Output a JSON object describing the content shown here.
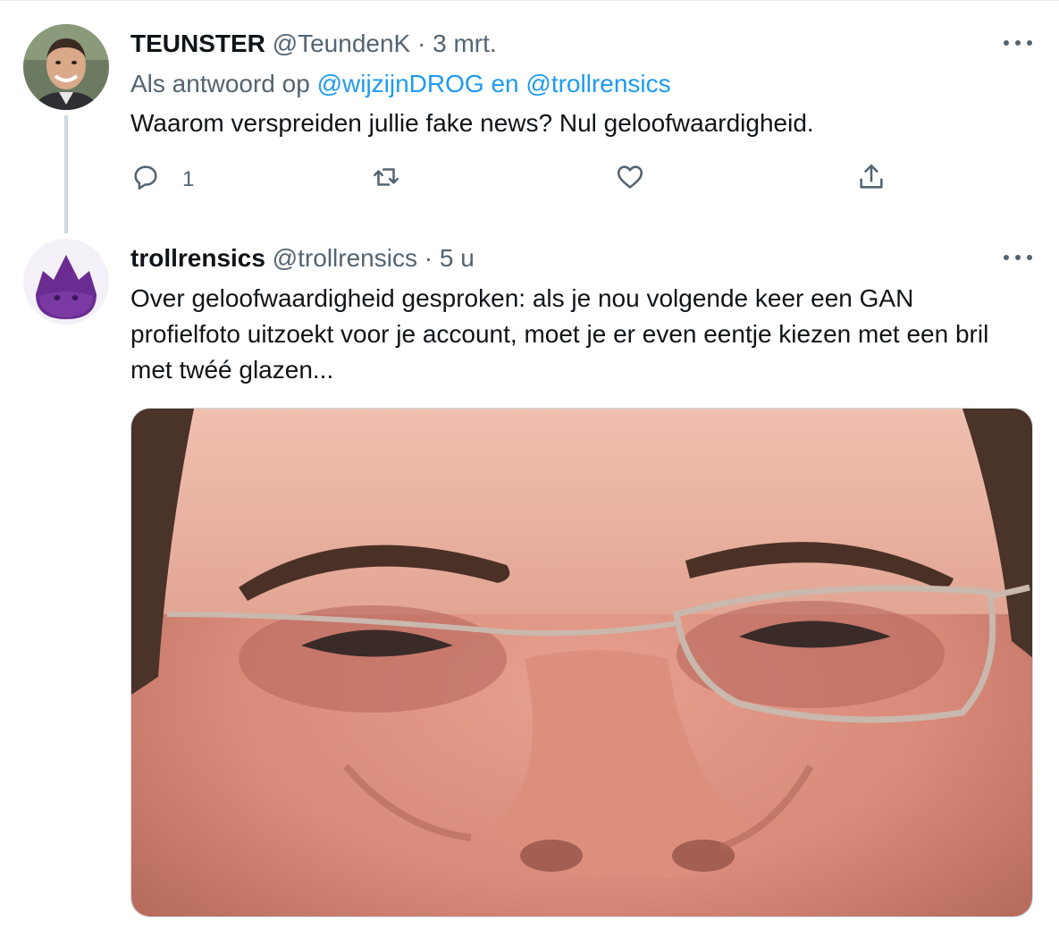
{
  "tweets": [
    {
      "display_name": "TEUNSTER",
      "handle": "@TeundenK",
      "separator": "·",
      "time": "3 mrt.",
      "reply_prefix": "Als antwoord op",
      "reply_mention_1": "@wijzijnDROG",
      "reply_conj": "en",
      "reply_mention_2": "@trollrensics",
      "text": "Waarom verspreiden jullie fake news? Nul geloofwaardigheid.",
      "actions": {
        "reply_count": "1",
        "reply_icon": "reply-icon",
        "retweet_icon": "retweet-icon",
        "like_icon": "heart-icon",
        "share_icon": "share-icon"
      },
      "more_icon": "more-icon"
    },
    {
      "display_name": "trollrensics",
      "handle": "@trollrensics",
      "separator": "·",
      "time": "5 u",
      "text": "Over geloofwaardigheid gesproken: als je nou volgende keer een GAN profielfoto uitzoekt voor je account, moet je er even eentje kiezen met een bril met twéé glazen...",
      "more_icon": "more-icon",
      "media": "close-up face photo with glasses"
    }
  ],
  "colors": {
    "text_primary": "#0f1419",
    "text_secondary": "#536471",
    "link": "#1d9bf0",
    "thread_line": "#cfd9de",
    "brand_purple": "#6a2c91"
  }
}
